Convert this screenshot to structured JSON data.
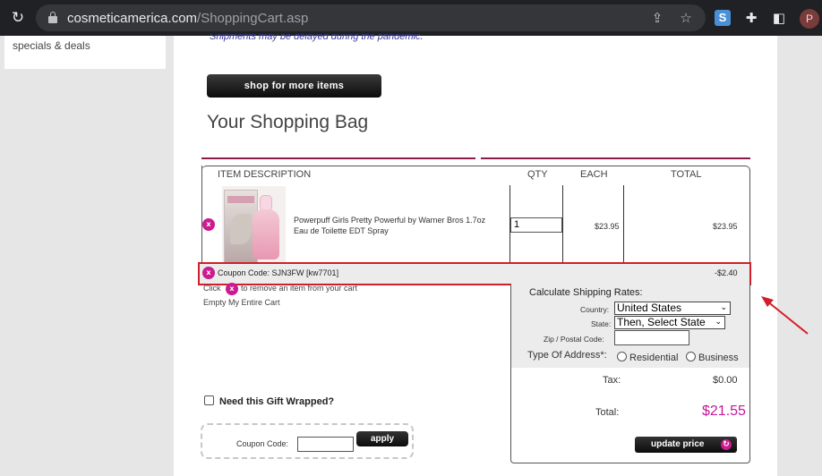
{
  "browser": {
    "url_domain": "cosmeticamerica.com",
    "url_path": "/ShoppingCart.asp",
    "profile_initial": "P",
    "extension_letter": "S"
  },
  "sidebar": {
    "link": "specials & deals"
  },
  "page": {
    "notice": "Shipments may be delayed during the pandemic.",
    "shop_button": "shop for more items",
    "title": "Your Shopping Bag"
  },
  "cart": {
    "headers": {
      "item": "ITEM",
      "description": "DESCRIPTION",
      "qty": "QTY",
      "each": "EACH",
      "total": "TOTAL"
    },
    "items": [
      {
        "name": "Powerpuff Girls Pretty Powerful by Warner Bros 1.7oz Eau de Toilette EDT Spray",
        "qty": "1",
        "each": "$23.95",
        "total": "$23.95"
      }
    ],
    "remove_glyph": "x",
    "coupon_line": "Coupon Code: SJN3FW [kw7701]",
    "coupon_discount": "-$2.40",
    "hint_prefix": "Click",
    "hint_suffix": "to remove an item from your cart",
    "empty_link": "Empty My Entire Cart"
  },
  "shipping": {
    "title": "Calculate Shipping Rates:",
    "country_label": "Country:",
    "country_value": "United States",
    "state_label": "State:",
    "state_value": "Then, Select State",
    "zip_label": "Zip / Postal Code:",
    "zip_value": "",
    "address_label": "Type Of Address*:",
    "address_options": [
      "Residential",
      "Business"
    ],
    "tax_label": "Tax:",
    "tax_value": "$0.00",
    "total_label": "Total:",
    "total_value": "$21.55",
    "update_button": "update price"
  },
  "gift": {
    "label": "Need this Gift Wrapped?",
    "checked": false
  },
  "coupon": {
    "label": "Coupon Code:",
    "value": "",
    "apply_button": "apply"
  },
  "colors": {
    "accent_magenta": "#cc1a8f",
    "rule_maroon": "#8b1c4a",
    "highlight_red": "#d01f2b",
    "notice_blue": "#3a3aa0"
  }
}
